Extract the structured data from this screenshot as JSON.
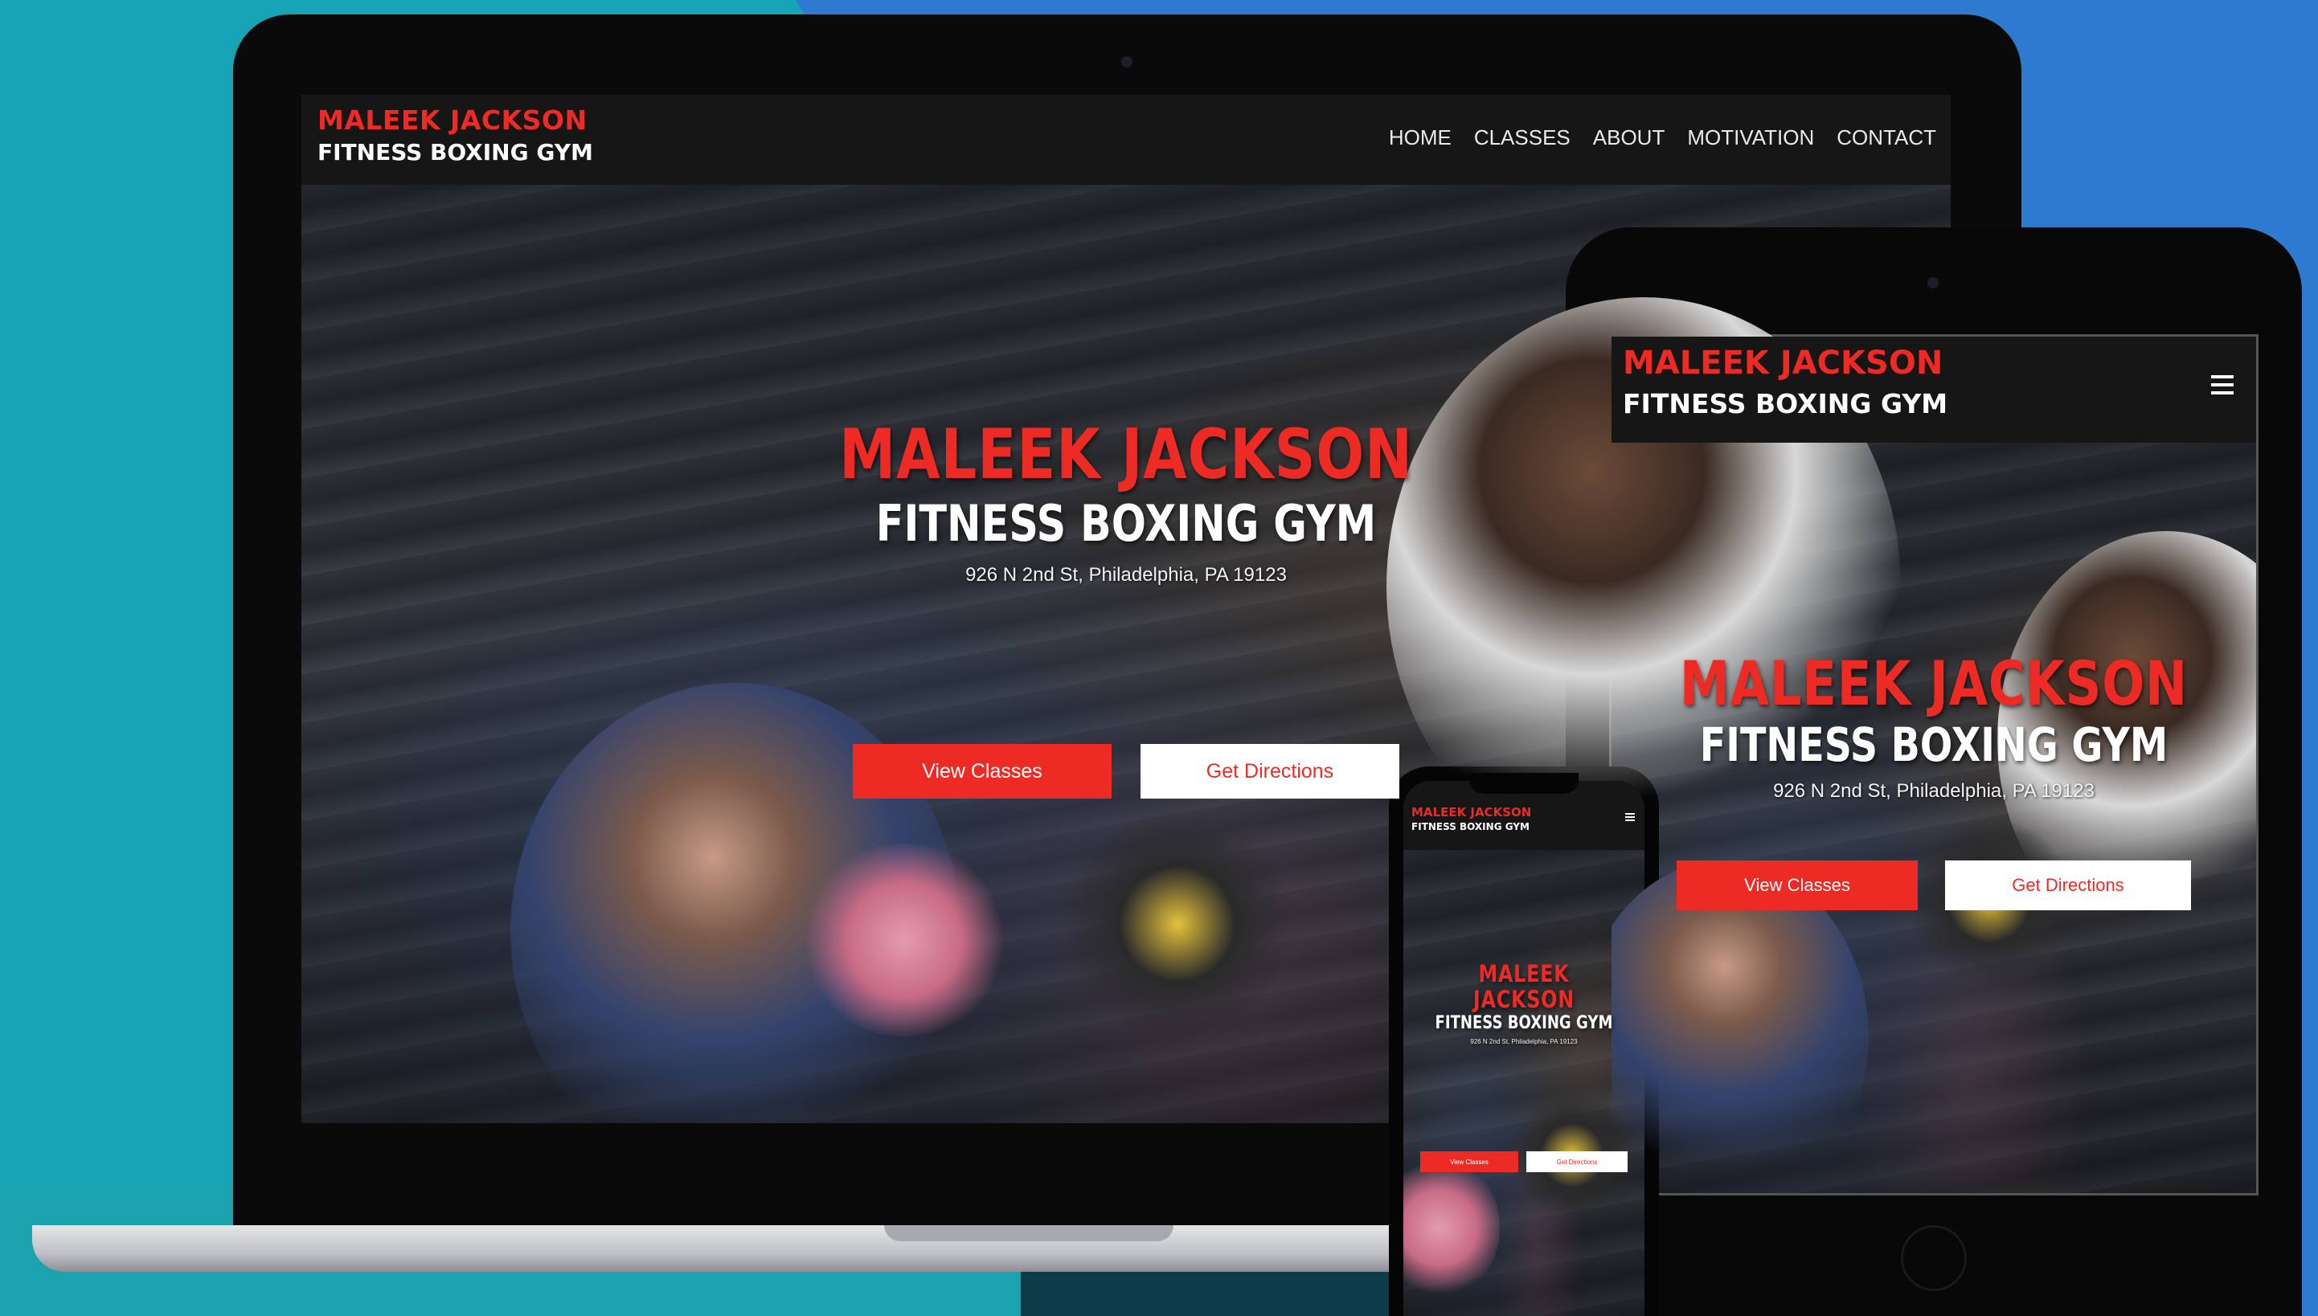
{
  "site": {
    "logo_line1": "MALEEK JACKSON",
    "logo_line2": "FITNESS BOXING GYM"
  },
  "nav": {
    "items": [
      "HOME",
      "CLASSES",
      "ABOUT",
      "MOTIVATION",
      "CONTACT"
    ],
    "menu_icon": "hamburger-menu-icon"
  },
  "hero": {
    "title_line1": "MALEEK JACKSON",
    "title_line2": "FITNESS BOXING GYM",
    "address": "926 N 2nd St, Philadelphia, PA 19123",
    "primary_button": "View Classes",
    "secondary_button": "Get Directions"
  },
  "colors": {
    "accent_red": "#ee2a24",
    "nav_background": "#161616",
    "background_teal": "#16a4b4",
    "background_blue": "#2e7ad1"
  }
}
